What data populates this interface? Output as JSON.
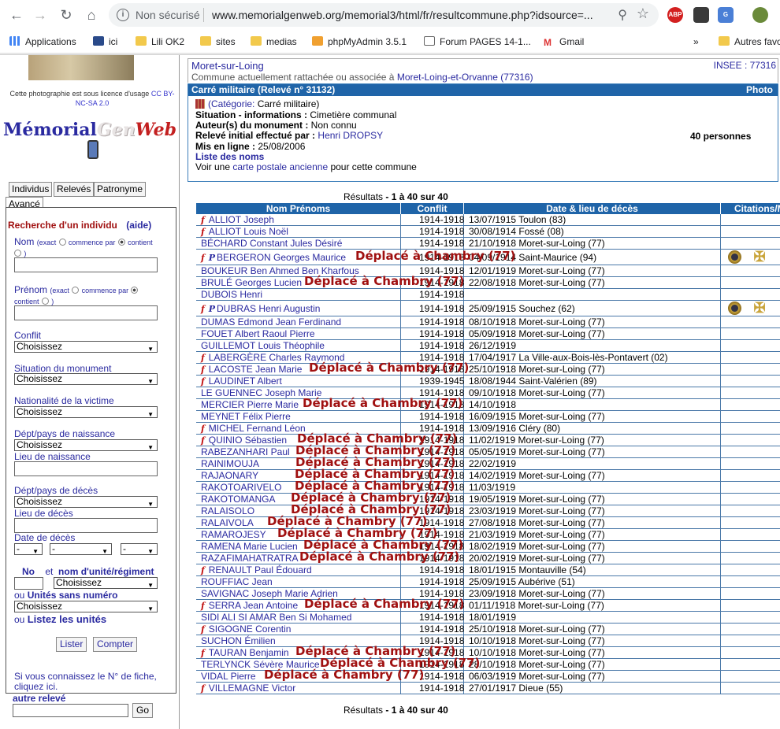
{
  "browser": {
    "not_secure": "Non sécurisé",
    "url": "www.memorialgenweb.org/memorial3/html/fr/resultcommune.php?idsource=...",
    "bookmarks": [
      "Applications",
      "ici",
      "Lili OK2",
      "sites",
      "medias",
      "phpMyAdmin 3.5.1",
      "Forum PAGES 14-1...",
      "Gmail",
      "Autres favo"
    ],
    "more": "»"
  },
  "sidebar": {
    "photo_license": "Cette photographie est sous licence d'usage",
    "license_link": "CC BY-NC-SA 2.0",
    "logo": {
      "m": "Mémorial",
      "g": "Gen",
      "w": "Web"
    },
    "tabs": [
      "Individus",
      "Relevés",
      "Patronyme",
      "Avancé"
    ],
    "search_title": "Recherche d'un individu",
    "help": "(aide)",
    "nom_label": "Nom",
    "prenom_label": "Prénom",
    "exact": "(exact",
    "commence": "commence par",
    "contient": "contient",
    "close_paren": ")",
    "conflit_label": "Conflit",
    "situation_label": "Situation",
    "situation_suffix": " du monument",
    "nationalite_label": "Nationalité",
    "nationalite_suffix": " de la victime",
    "dept_naissance_label": "Dépt/pays de naissance",
    "lieu_naissance_label": "Lieu de naissance",
    "dept_deces_label": "Dépt/pays de décès",
    "lieu_deces_label": "Lieu de décès",
    "date_deces_label": "Date de décès",
    "no_label": "No",
    "et_label": "et",
    "unite_label": "nom d'unité/régiment",
    "ou1": "ou",
    "unites_sans_numero": "Unités sans numéro",
    "ou2": "ou",
    "listez_unites": "Listez les unités",
    "choose": "Choisissez",
    "dash": "-",
    "lister": "Lister",
    "compter": "Compter",
    "fiche_text": "Si vous connaissez le N° de fiche, cliquez ici.",
    "autre_releve": "autre relevé",
    "go": "Go"
  },
  "commune": {
    "title": "Moret-sur-Loing",
    "subtitle": "Commune actuellement rattachée ou associée à",
    "subtitle_link": "Moret-Loing-et-Orvanne (77316)",
    "insee": "INSEE : 77316"
  },
  "releve": {
    "header": "Carré militaire (Relevé n° 31132)",
    "photo": "Photo",
    "categorie_prefix": "(Catégorie:",
    "categorie": " Carré militaire)",
    "situation_label": "Situation - informations :",
    "situation": " Cimetière communal",
    "auteur_label": "Auteur(s) du monument :",
    "auteur": " Non connu",
    "initial_label": "Relevé initial effectué par :",
    "initial": "Henri DROPSY",
    "enligne_label": "Mis en ligne :",
    "enligne": " 25/08/2006",
    "liste": "Liste des noms",
    "voir_prefix": "Voir une ",
    "voir_link": "carte postale ancienne",
    "voir_suffix": " pour cette commune",
    "persons": "40 personnes"
  },
  "results": {
    "label": "Résultats",
    "range": " - 1 à 40 sur 40"
  },
  "table": {
    "headers": [
      "Nom Prénoms",
      "Conflit",
      "Date & lieu de décès",
      "Citations/M"
    ],
    "rows": [
      {
        "f": "f",
        "p": "",
        "name": "ALLIOT Joseph",
        "conflit": "1914-1918",
        "deces": "13/07/1915 Toulon (83)",
        "dep": ""
      },
      {
        "f": "f",
        "p": "",
        "name": "ALLIOT Louis Noël",
        "conflit": "1914-1918",
        "deces": "30/08/1914 Fossé (08)",
        "dep": ""
      },
      {
        "f": "",
        "p": "",
        "name": "BÉCHARD Constant Jules Désiré",
        "conflit": "1914-1918",
        "deces": "21/10/1918 Moret-sur-Loing (77)",
        "dep": ""
      },
      {
        "f": "f",
        "p": "P",
        "name": "BERGERON Georges Maurice",
        "conflit": "1914-1918",
        "deces": "04/09/1914 Saint-Maurice (94)",
        "dep": "Déplacé à Chambry (77)"
      },
      {
        "f": "",
        "p": "",
        "name": "BOUKEUR Ben Ahmed Ben Kharfous",
        "conflit": "1914-1918",
        "deces": "12/01/1919 Moret-sur-Loing (77)",
        "dep": ""
      },
      {
        "f": "",
        "p": "",
        "name": "BRULÉ Georges Lucien",
        "conflit": "1914-1918",
        "deces": "22/08/1918 Moret-sur-Loing (77)",
        "dep": "Déplacé à Chambry (77)"
      },
      {
        "f": "",
        "p": "",
        "name": "DUBOIS Henri",
        "conflit": "1914-1918",
        "deces": "",
        "dep": ""
      },
      {
        "f": "f",
        "p": "P",
        "name": "DUBRAS Henri Augustin",
        "conflit": "1914-1918",
        "deces": "25/09/1915 Souchez (62)",
        "dep": ""
      },
      {
        "f": "",
        "p": "",
        "name": "DUMAS Edmond Jean Ferdinand",
        "conflit": "1914-1918",
        "deces": "08/10/1918 Moret-sur-Loing (77)",
        "dep": ""
      },
      {
        "f": "",
        "p": "",
        "name": "FOUET Albert Raoul Pierre",
        "conflit": "1914-1918",
        "deces": "05/09/1918 Moret-sur-Loing (77)",
        "dep": ""
      },
      {
        "f": "",
        "p": "",
        "name": "GUILLEMOT Louis Théophile",
        "conflit": "1914-1918",
        "deces": "26/12/1919",
        "dep": ""
      },
      {
        "f": "f",
        "p": "",
        "name": "LABERGÈRE Charles Raymond",
        "conflit": "1914-1918",
        "deces": "17/04/1917 La Ville-aux-Bois-lès-Pontavert (02)",
        "dep": ""
      },
      {
        "f": "f",
        "p": "",
        "name": "LACOSTE Jean Marie",
        "conflit": "1914-1918",
        "deces": "25/10/1918 Moret-sur-Loing (77)",
        "dep": "Déplacé à Chambry (77)"
      },
      {
        "f": "f",
        "p": "",
        "name": "LAUDINET Albert",
        "conflit": "1939-1945",
        "deces": "18/08/1944 Saint-Valérien (89)",
        "dep": ""
      },
      {
        "f": "",
        "p": "",
        "name": "LE GUENNEC Joseph Marie",
        "conflit": "1914-1918",
        "deces": "09/10/1918 Moret-sur-Loing (77)",
        "dep": ""
      },
      {
        "f": "",
        "p": "",
        "name": "MERCIER Pierre Marie",
        "conflit": "1914-1918",
        "deces": "14/10/1918",
        "dep": "Déplacé à Chambry (77)"
      },
      {
        "f": "",
        "p": "",
        "name": "MEYNET Félix Pierre",
        "conflit": "1914-1918",
        "deces": "16/09/1915 Moret-sur-Loing (77)",
        "dep": ""
      },
      {
        "f": "f",
        "p": "",
        "name": "MICHEL Fernand Léon",
        "conflit": "1914-1918",
        "deces": "13/09/1916 Cléry (80)",
        "dep": ""
      },
      {
        "f": "f",
        "p": "",
        "name": "QUINIO Sébastien",
        "conflit": "1914-1918",
        "deces": "11/02/1919 Moret-sur-Loing (77)",
        "dep": "Déplacé à Chambry (77)"
      },
      {
        "f": "",
        "p": "",
        "name": "RABEZANHARI Paul",
        "conflit": "1914-1918",
        "deces": "05/05/1919 Moret-sur-Loing (77)",
        "dep": "Déplacé à Chambry (77)"
      },
      {
        "f": "",
        "p": "",
        "name": "RAINIMOUJA",
        "conflit": "1914-1918",
        "deces": "22/02/1919",
        "dep": "Déplacé à Chambry (77)"
      },
      {
        "f": "",
        "p": "",
        "name": "RAJAONARY",
        "conflit": "1914-1918",
        "deces": "14/02/1919 Moret-sur-Loing (77)",
        "dep": "Déplacé à Chambry (77)"
      },
      {
        "f": "",
        "p": "",
        "name": "RAKOTOARIVELO",
        "conflit": "1914-1918",
        "deces": "11/03/1919",
        "dep": "Déplacé à Chambry (77)"
      },
      {
        "f": "",
        "p": "",
        "name": "RAKOTOMANGA",
        "conflit": "1914-1918",
        "deces": "19/05/1919 Moret-sur-Loing (77)",
        "dep": "Déplacé à Chambry (77)"
      },
      {
        "f": "",
        "p": "",
        "name": "RALAISOLO",
        "conflit": "1914-1918",
        "deces": "23/03/1919 Moret-sur-Loing (77)",
        "dep": "Déplacé à Chambry (77)"
      },
      {
        "f": "",
        "p": "",
        "name": "RALAIVOLA",
        "conflit": "1914-1918",
        "deces": "27/08/1918 Moret-sur-Loing (77)",
        "dep": "Déplacé à Chambry (77)"
      },
      {
        "f": "",
        "p": "",
        "name": "RAMAROJESY",
        "conflit": "1914-1918",
        "deces": "21/03/1919 Moret-sur-Loing (77)",
        "dep": "Déplacé à Chambry (77)"
      },
      {
        "f": "",
        "p": "",
        "name": "RAMENA Marie Lucien",
        "conflit": "1914-1918",
        "deces": "18/02/1919 Moret-sur-Loing (77)",
        "dep": "Déplacé à Chambry (77)"
      },
      {
        "f": "",
        "p": "",
        "name": "RAZAFIMAHATRATRA",
        "conflit": "1914-1918",
        "deces": "20/02/1919 Moret-sur-Loing (77)",
        "dep": "Déplacé à Chambry (77)"
      },
      {
        "f": "f",
        "p": "",
        "name": "RENAULT Paul Édouard",
        "conflit": "1914-1918",
        "deces": "18/01/1915 Montauville (54)",
        "dep": ""
      },
      {
        "f": "",
        "p": "",
        "name": "ROUFFIAC Jean",
        "conflit": "1914-1918",
        "deces": "25/09/1915 Aubérive (51)",
        "dep": ""
      },
      {
        "f": "",
        "p": "",
        "name": "SAVIGNAC Joseph Marie Adrien",
        "conflit": "1914-1918",
        "deces": "23/09/1918 Moret-sur-Loing (77)",
        "dep": ""
      },
      {
        "f": "f",
        "p": "",
        "name": "SERRA Jean Antoine",
        "conflit": "1914-1918",
        "deces": "01/11/1918 Moret-sur-Loing (77)",
        "dep": "Déplacé à Chambry (77)"
      },
      {
        "f": "",
        "p": "",
        "name": "SIDI ALI SI AMAR Ben Si Mohamed",
        "conflit": "1914-1918",
        "deces": "18/01/1919",
        "dep": ""
      },
      {
        "f": "f",
        "p": "",
        "name": "SIGOGNE Corentin",
        "conflit": "1914-1918",
        "deces": "25/10/1918 Moret-sur-Loing (77)",
        "dep": ""
      },
      {
        "f": "",
        "p": "",
        "name": "SUCHON Émilien",
        "conflit": "1914-1918",
        "deces": "10/10/1918 Moret-sur-Loing (77)",
        "dep": ""
      },
      {
        "f": "f",
        "p": "",
        "name": "TAURAN Benjamin",
        "conflit": "1914-1918",
        "deces": "10/10/1918 Moret-sur-Loing (77)",
        "dep": "Déplacé à Chambry (77)"
      },
      {
        "f": "",
        "p": "",
        "name": "TERLYNCK Sévère Maurice",
        "conflit": "1914-1918",
        "deces": "28/10/1918 Moret-sur-Loing (77)",
        "dep": "Déplacé à Chambry (77)"
      },
      {
        "f": "",
        "p": "",
        "name": "VIDAL Pierre",
        "conflit": "1914-1918",
        "deces": "06/03/1919 Moret-sur-Loing (77)",
        "dep": "Déplacé à Chambry (77)"
      },
      {
        "f": "f",
        "p": "",
        "name": "VILLEMAGNE Victor",
        "conflit": "1914-1918",
        "deces": "27/01/1917 Dieue (55)",
        "dep": ""
      }
    ]
  }
}
